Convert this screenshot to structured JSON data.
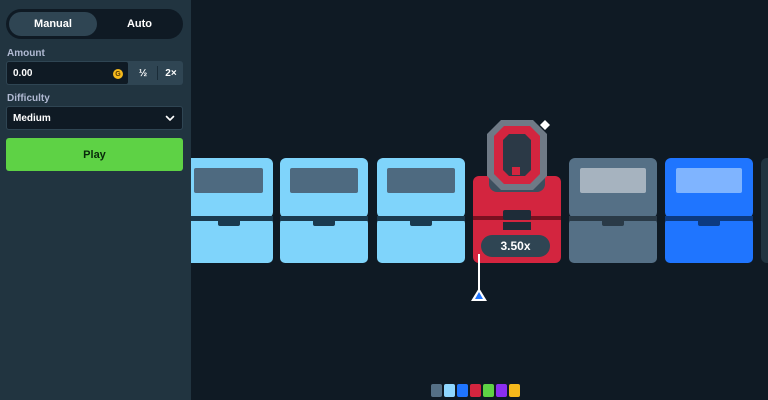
{
  "controls": {
    "modes": [
      {
        "label": "Manual",
        "active": true
      },
      {
        "label": "Auto",
        "active": false
      }
    ],
    "amount": {
      "label": "Amount",
      "value": "0.00",
      "coin_symbol": "G",
      "half_label": "½",
      "double_label": "2×"
    },
    "difficulty": {
      "label": "Difficulty",
      "selected": "Medium"
    },
    "play_label": "Play"
  },
  "game": {
    "tiles": [
      {
        "state": "light-blue",
        "icon": "open-drawer-icon"
      },
      {
        "state": "light-blue",
        "icon": "open-drawer-icon"
      },
      {
        "state": "light-blue",
        "icon": "open-drawer-icon"
      },
      {
        "state": "red-gem",
        "icon": "red-gem-icon"
      },
      {
        "state": "gray",
        "icon": "open-drawer-icon"
      },
      {
        "state": "blue",
        "icon": "open-drawer-icon"
      }
    ],
    "current_multiplier": "3.50x",
    "palette_colors": [
      "#557086",
      "#8fd7ff",
      "#1f75ff",
      "#d3253f",
      "#5ed245",
      "#8b2ef0",
      "#f5b91c"
    ],
    "colors": {
      "accent_green": "#5ed245",
      "light_blue": "#7fd4fb",
      "gray": "#557086",
      "blue": "#1f75ff",
      "red": "#d3253f"
    }
  }
}
